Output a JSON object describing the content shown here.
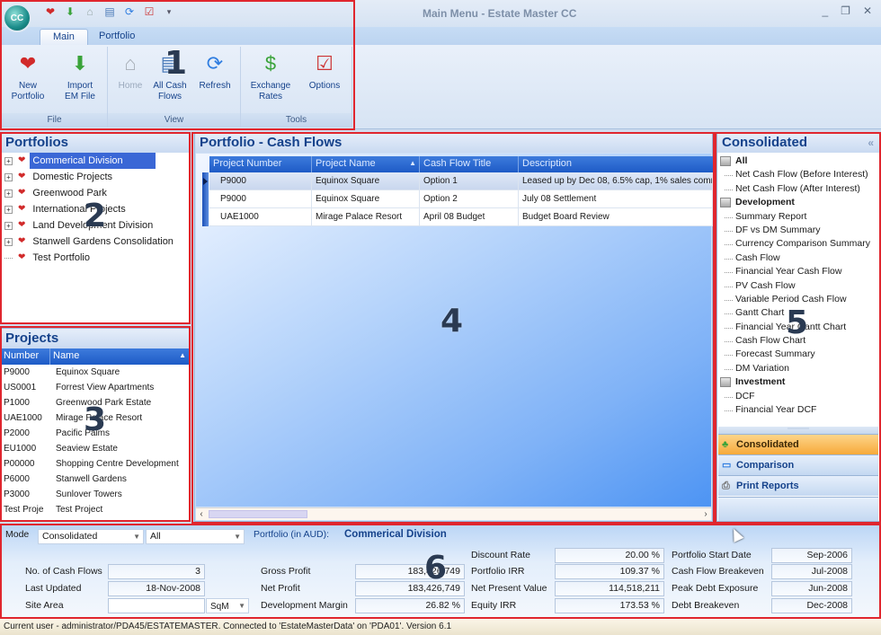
{
  "window": {
    "title": "Main Menu - Estate Master CC",
    "app_button_label": "CC",
    "controls": {
      "minimize": "_",
      "restore": "❐",
      "close": "✕"
    },
    "quick_access": [
      "new-portfolio-icon",
      "import-icon",
      "home-icon",
      "all-cash-flows-icon",
      "refresh-icon",
      "options-icon",
      "customize-qat-icon"
    ]
  },
  "ribbon": {
    "tabs": [
      {
        "label": "Main",
        "active": true
      },
      {
        "label": "Portfolio",
        "active": false
      }
    ],
    "groups": [
      {
        "label": "File",
        "buttons": [
          {
            "label": "New Portfolio",
            "line1": "New",
            "line2": "Portfolio",
            "icon": "new-portfolio-icon",
            "enabled": true
          },
          {
            "label": "Import EM File",
            "line1": "Import",
            "line2": "EM File",
            "icon": "import-icon",
            "enabled": true
          }
        ]
      },
      {
        "label": "View",
        "buttons": [
          {
            "label": "Home",
            "line1": "Home",
            "line2": "",
            "icon": "home-icon",
            "enabled": false
          },
          {
            "label": "All Cash Flows",
            "line1": "All Cash",
            "line2": "Flows",
            "icon": "all-cash-flows-icon",
            "enabled": true
          },
          {
            "label": "Refresh",
            "line1": "Refresh",
            "line2": "",
            "icon": "refresh-icon",
            "enabled": true
          }
        ]
      },
      {
        "label": "Tools",
        "buttons": [
          {
            "label": "Exchange Rates",
            "line1": "Exchange",
            "line2": "Rates",
            "icon": "exchange-rates-icon",
            "enabled": true
          },
          {
            "label": "Options",
            "line1": "Options",
            "line2": "",
            "icon": "options-icon",
            "enabled": true
          }
        ]
      }
    ]
  },
  "portfolios": {
    "title": "Portfolios",
    "items": [
      {
        "label": "Commerical Division",
        "expandable": true,
        "selected": true
      },
      {
        "label": "Domestic Projects",
        "expandable": true,
        "selected": false
      },
      {
        "label": "Greenwood Park",
        "expandable": true,
        "selected": false
      },
      {
        "label": "International Projects",
        "expandable": true,
        "selected": false
      },
      {
        "label": "Land Development Division",
        "expandable": true,
        "selected": false
      },
      {
        "label": "Stanwell Gardens Consolidation",
        "expandable": true,
        "selected": false
      },
      {
        "label": "Test Portfolio",
        "expandable": false,
        "selected": false
      }
    ]
  },
  "projects": {
    "title": "Projects",
    "columns": [
      "Number",
      "Name"
    ],
    "sort_indicator": "▲",
    "rows": [
      [
        "P9000",
        "Equinox Square"
      ],
      [
        "US0001",
        "Forrest View Apartments"
      ],
      [
        "P1000",
        "Greenwood Park Estate"
      ],
      [
        "UAE1000",
        "Mirage Palace Resort"
      ],
      [
        "P2000",
        "Pacific Palms"
      ],
      [
        "EU1000",
        "Seaview Estate"
      ],
      [
        "P00000",
        "Shopping Centre Development"
      ],
      [
        "P6000",
        "Stanwell Gardens"
      ],
      [
        "P3000",
        "Sunlover Towers"
      ],
      [
        "Test Proje",
        "Test Project"
      ]
    ]
  },
  "cash_flows": {
    "title": "Portfolio - Cash Flows",
    "columns": [
      "Project Number",
      "Project Name",
      "Cash Flow Title",
      "Description"
    ],
    "sort_indicator": "▲",
    "rows": [
      [
        "P9000",
        "Equinox Square",
        "Option 1",
        "Leased up by Dec 08, 6.5% cap, 1% sales comm"
      ],
      [
        "P9000",
        "Equinox Square",
        "Option 2",
        "July 08 Settlement"
      ],
      [
        "UAE1000",
        "Mirage Palace Resort",
        "April 08 Budget",
        "Budget Board Review"
      ]
    ],
    "selected_row": 0
  },
  "reports": {
    "title": "Consolidated",
    "collapse_label": "«",
    "items": [
      {
        "label": "All",
        "category": true
      },
      {
        "label": "Net Cash Flow (Before Interest)",
        "category": false
      },
      {
        "label": "Net Cash Flow (After Interest)",
        "category": false
      },
      {
        "label": "Development",
        "category": true
      },
      {
        "label": "Summary Report",
        "category": false
      },
      {
        "label": "DF vs DM Summary",
        "category": false
      },
      {
        "label": "Currency  Comparison  Summary",
        "category": false
      },
      {
        "label": "Cash Flow",
        "category": false
      },
      {
        "label": "Financial Year Cash Flow",
        "category": false
      },
      {
        "label": "PV Cash Flow",
        "category": false
      },
      {
        "label": "Variable Period Cash Flow",
        "category": false
      },
      {
        "label": "Gantt Chart",
        "category": false
      },
      {
        "label": "Financial Year Gantt Chart",
        "category": false
      },
      {
        "label": "Cash Flow Chart",
        "category": false
      },
      {
        "label": "Forecast Summary",
        "category": false
      },
      {
        "label": "DM Variation",
        "category": false
      },
      {
        "label": "Investment",
        "category": true
      },
      {
        "label": "DCF",
        "category": false
      },
      {
        "label": "Financial Year DCF",
        "category": false
      }
    ],
    "nav_buttons": [
      {
        "label": "Consolidated",
        "active": true,
        "icon": "consolidated-icon"
      },
      {
        "label": "Comparison",
        "active": false,
        "icon": "comparison-icon"
      },
      {
        "label": "Print Reports",
        "active": false,
        "icon": "print-icon"
      }
    ]
  },
  "summary": {
    "mode_label": "Mode",
    "mode_value": "Consolidated",
    "filter_value": "All",
    "portfolio_label": "Portfolio (in AUD):",
    "portfolio_name": "Commerical Division",
    "fields": {
      "no_of_cash_flows": {
        "label": "No. of Cash Flows",
        "value": "3"
      },
      "last_updated": {
        "label": "Last Updated",
        "value": "18-Nov-2008"
      },
      "site_area": {
        "label": "Site Area",
        "value": "",
        "unit": "SqM"
      },
      "gross_profit": {
        "label": "Gross Profit",
        "value": "183,426,749"
      },
      "net_profit": {
        "label": "Net Profit",
        "value": "183,426,749"
      },
      "development_margin": {
        "label": "Development Margin",
        "value": "26.82 %"
      },
      "discount_rate": {
        "label": "Discount Rate",
        "value": "20.00 %"
      },
      "portfolio_irr": {
        "label": "Portfolio IRR",
        "value": "109.37 %"
      },
      "net_present_value": {
        "label": "Net Present Value",
        "value": "114,518,211"
      },
      "equity_irr": {
        "label": "Equity IRR",
        "value": "173.53 %"
      },
      "portfolio_start_date": {
        "label": "Portfolio Start Date",
        "value": "Sep-2006"
      },
      "cash_flow_breakeven": {
        "label": "Cash Flow Breakeven",
        "value": "Jul-2008"
      },
      "peak_debt_exposure": {
        "label": "Peak Debt Exposure",
        "value": "Jun-2008"
      },
      "debt_breakeven": {
        "label": "Debt Breakeven",
        "value": "Dec-2008"
      }
    }
  },
  "status_bar": {
    "text": "Current user - administrator/PDA45/ESTATEMASTER.    Connected to 'EstateMasterData' on 'PDA01'.  Version 6.1"
  },
  "annotations": {
    "color": "#e0262e",
    "labels": [
      "1",
      "2",
      "3",
      "4",
      "5",
      "6"
    ]
  }
}
